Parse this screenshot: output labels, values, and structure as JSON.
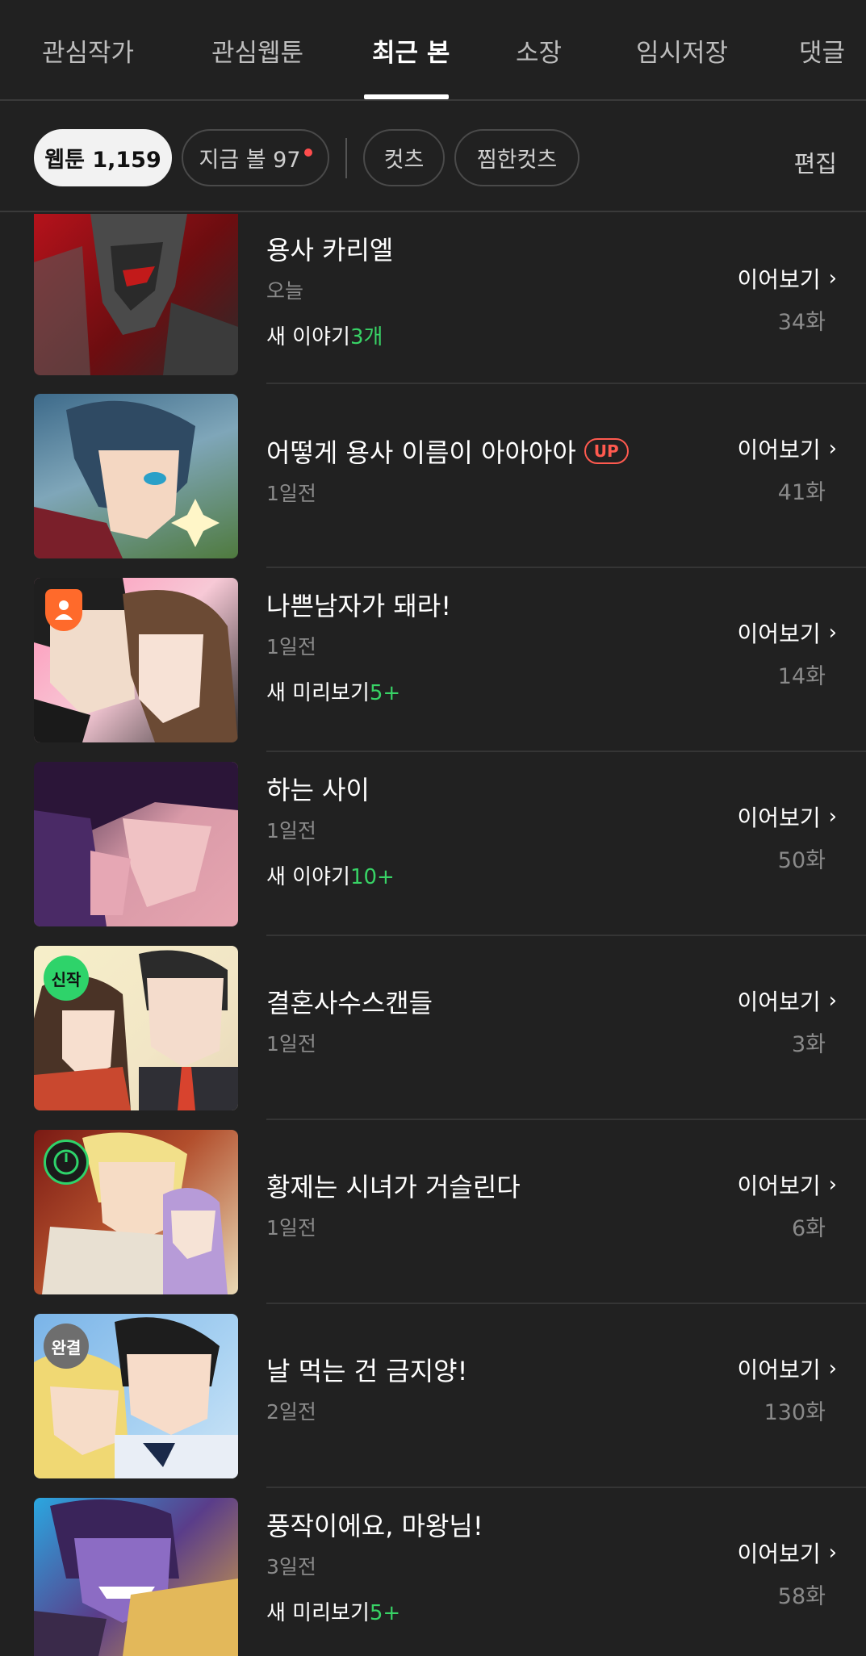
{
  "tabs": [
    {
      "label": "관심작가",
      "active": false
    },
    {
      "label": "관심웹툰",
      "active": false
    },
    {
      "label": "최근 본",
      "active": true
    },
    {
      "label": "소장",
      "active": false
    },
    {
      "label": "임시저장",
      "active": false
    },
    {
      "label": "댓글",
      "active": false
    }
  ],
  "filters": {
    "chips": [
      {
        "label": "웹툰 1,159",
        "selected": true
      },
      {
        "label": "지금 볼 97",
        "selected": false,
        "has_dot": true
      },
      {
        "label": "컷츠",
        "selected": false
      },
      {
        "label": "찜한컷츠",
        "selected": false
      }
    ],
    "edit_label": "편집"
  },
  "items": [
    {
      "title": "용사 카리엘",
      "time": "오늘",
      "new_label": "새 이야기",
      "new_count": "3개",
      "continue_label": "이어보기",
      "episode": "34화"
    },
    {
      "title": "어떻게 용사 이름이 아아아아",
      "badge": "UP",
      "time": "1일전",
      "continue_label": "이어보기",
      "episode": "41화"
    },
    {
      "title": "나쁜남자가 돼라!",
      "time": "1일전",
      "new_label": "새 미리보기",
      "new_count": "5+",
      "continue_label": "이어보기",
      "episode": "14화",
      "corner_badge": "person-icon"
    },
    {
      "title": "하는 사이",
      "time": "1일전",
      "new_label": "새 이야기",
      "new_count": "10+",
      "continue_label": "이어보기",
      "episode": "50화"
    },
    {
      "title": "결혼사수스캔들",
      "time": "1일전",
      "continue_label": "이어보기",
      "episode": "3화",
      "corner_badge_text": "신작"
    },
    {
      "title": "황제는 시녀가 거슬린다",
      "time": "1일전",
      "continue_label": "이어보기",
      "episode": "6화",
      "corner_badge": "timer-icon"
    },
    {
      "title": "날 먹는 건 금지양!",
      "time": "2일전",
      "continue_label": "이어보기",
      "episode": "130화",
      "corner_badge_text": "완결"
    },
    {
      "title": "풍작이에요, 마왕님!",
      "time": "3일전",
      "new_label": "새 미리보기",
      "new_count": "5+",
      "continue_label": "이어보기",
      "episode": "58화"
    }
  ],
  "colors": {
    "background": "#212121",
    "accent_green": "#38d366",
    "up_red": "#ff5a4f"
  }
}
